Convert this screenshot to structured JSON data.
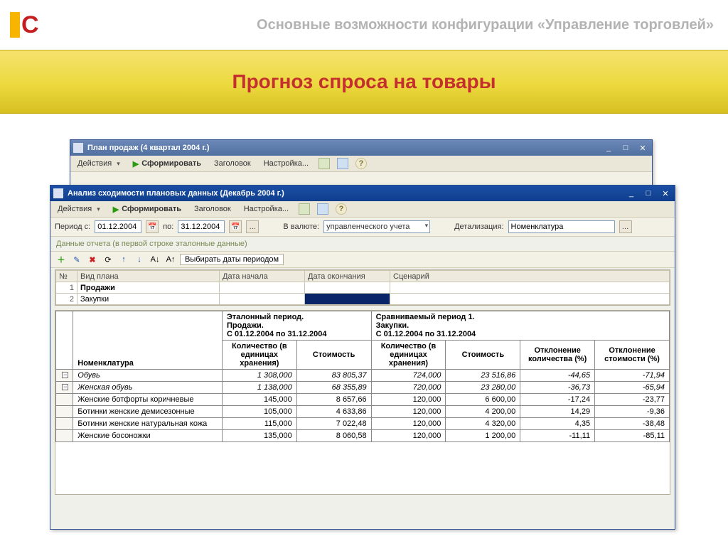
{
  "slide": {
    "subtitle": "Основные возможности конфигурации «Управление торговлей»",
    "title": "Прогноз спроса на товары"
  },
  "bg_window": {
    "title": "План продаж (4 квартал 2004 г.)",
    "actions": "Действия",
    "generate": "Сформировать",
    "header_btn": "Заголовок",
    "settings": "Настройка..."
  },
  "fg_window": {
    "title": "Анализ сходимости плановых данных (Декабрь 2004 г.)",
    "actions": "Действия",
    "generate": "Сформировать",
    "header_btn": "Заголовок",
    "settings": "Настройка...",
    "period_from_lbl": "Период с:",
    "period_from": "01.12.2004",
    "period_to_lbl": "по:",
    "period_to": "31.12.2004",
    "currency_lbl": "В валюте:",
    "currency": "управленческого учета",
    "detail_lbl": "Детализация:",
    "detail": "Номенклатура",
    "hint": "Данные отчета (в первой строке эталонные данные)",
    "pick_dates": "Выбирать даты периодом",
    "grid_cols": {
      "n": "№",
      "type": "Вид плана",
      "start": "Дата начала",
      "end": "Дата окончания",
      "scenario": "Сценарий"
    },
    "grid_rows": [
      {
        "n": "1",
        "type": "Продажи"
      },
      {
        "n": "2",
        "type": "Закупки"
      }
    ]
  },
  "report": {
    "row_label": "Номенклатура",
    "ref_period_title": "Эталонный период.\nПродажи.\nС 01.12.2004 по 31.12.2004",
    "cmp_period_title": "Сравниваемый период 1.\nЗакупки.\nС 01.12.2004 по 31.12.2004",
    "qty_h": "Количество (в единицах хранения)",
    "cost_h": "Стоимость",
    "dev_qty_h": "Отклонение количества (%)",
    "dev_cost_h": "Отклонение стоимости (%)",
    "rows": [
      {
        "name": "Обувь",
        "it": true,
        "q1": "1 308,000",
        "c1": "83 805,37",
        "q2": "724,000",
        "c2": "23 516,86",
        "dq": "-44,65",
        "dc": "-71,94"
      },
      {
        "name": "Женская обувь",
        "it": true,
        "q1": "1 138,000",
        "c1": "68 355,89",
        "q2": "720,000",
        "c2": "23 280,00",
        "dq": "-36,73",
        "dc": "-65,94"
      },
      {
        "name": "Женские ботфорты коричневые",
        "q1": "145,000",
        "c1": "8 657,66",
        "q2": "120,000",
        "c2": "6 600,00",
        "dq": "-17,24",
        "dc": "-23,77"
      },
      {
        "name": "Ботинки женские демисезонные",
        "q1": "105,000",
        "c1": "4 633,86",
        "q2": "120,000",
        "c2": "4 200,00",
        "dq": "14,29",
        "dc": "-9,36"
      },
      {
        "name": "Ботинки женские натуральная кожа",
        "q1": "115,000",
        "c1": "7 022,48",
        "q2": "120,000",
        "c2": "4 320,00",
        "dq": "4,35",
        "dc": "-38,48"
      },
      {
        "name": "Женские босоножки",
        "q1": "135,000",
        "c1": "8 060,58",
        "q2": "120,000",
        "c2": "1 200,00",
        "dq": "-11,11",
        "dc": "-85,11"
      }
    ]
  }
}
